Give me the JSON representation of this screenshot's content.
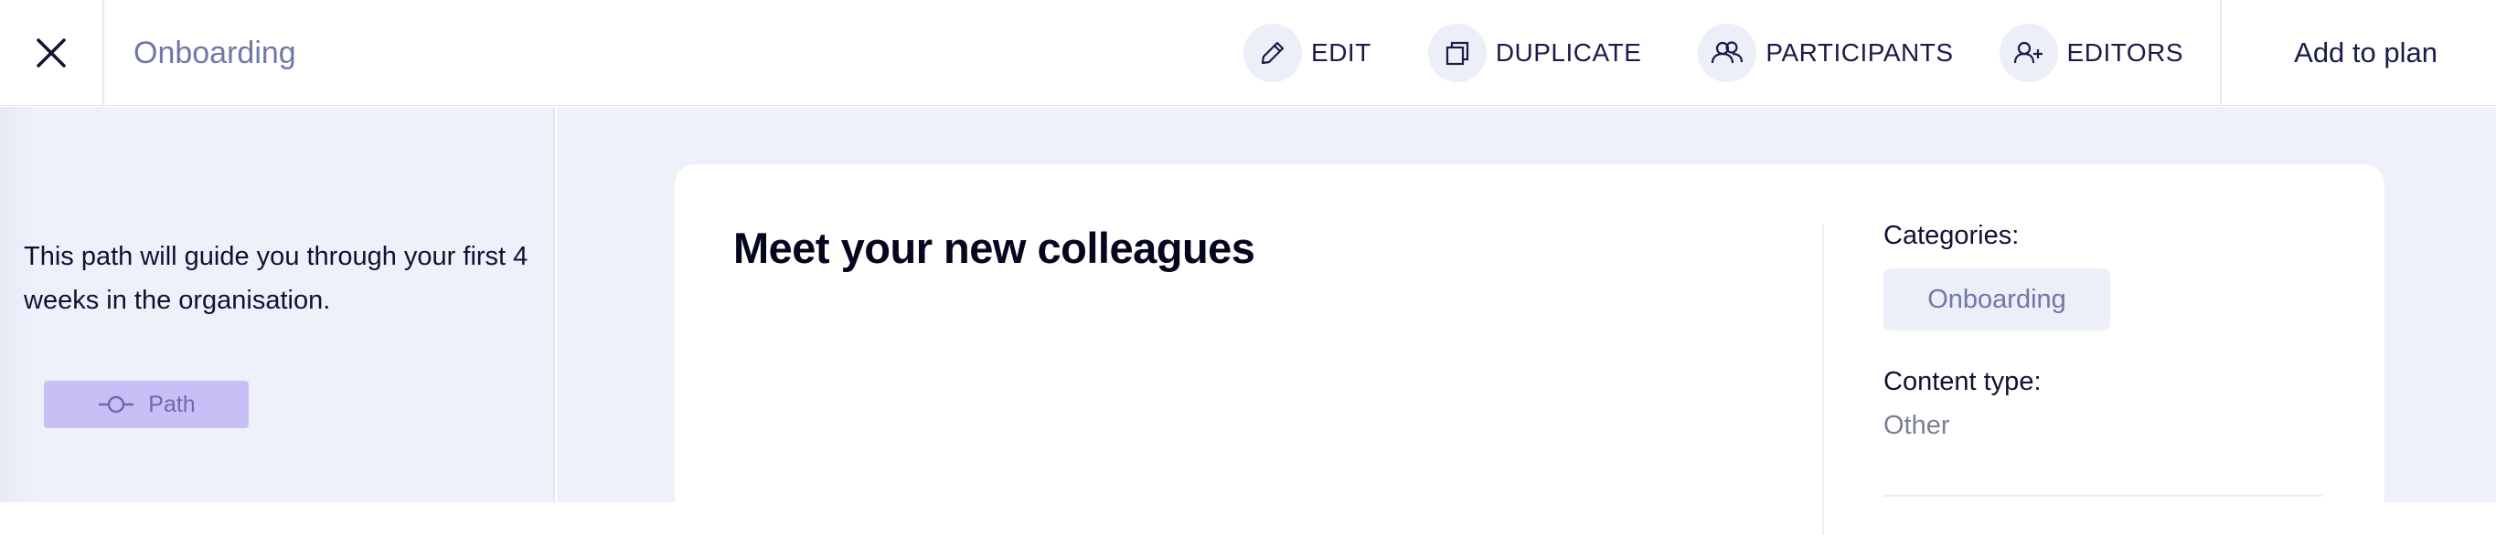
{
  "header": {
    "close_icon": "close-icon",
    "title": "Onboarding",
    "actions": [
      {
        "label": "EDIT",
        "icon": "pencil-icon"
      },
      {
        "label": "DUPLICATE",
        "icon": "duplicate-icon"
      },
      {
        "label": "PARTICIPANTS",
        "icon": "participants-icon"
      },
      {
        "label": "EDITORS",
        "icon": "add-user-icon"
      }
    ],
    "add_to_plan_label": "Add to plan"
  },
  "sidebar": {
    "description": "This path will guide you through your first 4 weeks in the organisation.",
    "path_badge_label": "Path",
    "path_badge_icon": "path-icon"
  },
  "card": {
    "title": "Meet your new colleagues",
    "categories_label": "Categories:",
    "category_chip": "Onboarding",
    "content_type_label": "Content type:",
    "content_type_value": "Other"
  },
  "colors": {
    "accent_text": "#1a1b4b",
    "muted_text": "#6f78a8",
    "badge_bg": "#c7bff5",
    "page_bg": "#eef0fa"
  }
}
